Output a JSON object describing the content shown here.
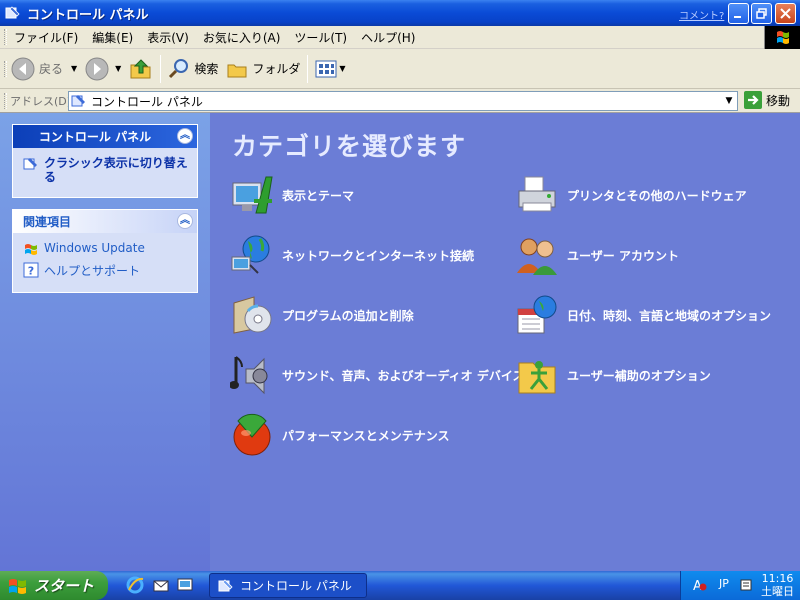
{
  "window": {
    "title": "コントロール パネル",
    "comment_link": "コメント?"
  },
  "menu": [
    "ファイル(F)",
    "編集(E)",
    "表示(V)",
    "お気に入り(A)",
    "ツール(T)",
    "ヘルプ(H)"
  ],
  "toolbar": {
    "back_label": "戻る",
    "search_label": "検索",
    "folders_label": "フォルダ"
  },
  "address": {
    "label": "アドレス(D)",
    "value": "コントロール パネル",
    "go_label": "移動"
  },
  "sidebar": {
    "panel1": {
      "title": "コントロール パネル",
      "link": "クラシック表示に切り替える"
    },
    "panel2": {
      "title": "関連項目",
      "links": [
        "Windows Update",
        "ヘルプとサポート"
      ]
    }
  },
  "main": {
    "heading": "カテゴリを選びます",
    "categories": [
      "表示とテーマ",
      "プリンタとその他のハードウェア",
      "ネットワークとインターネット接続",
      "ユーザー アカウント",
      "プログラムの追加と削除",
      "日付、時刻、言語と地域のオプション",
      "サウンド、音声、およびオーディオ デバイス",
      "ユーザー補助のオプション",
      "パフォーマンスとメンテナンス"
    ]
  },
  "taskbar": {
    "start_label": "スタート",
    "task_label": "コントロール パネル",
    "tray_ime": "JP",
    "clock_time": "11:16",
    "clock_day": "土曜日"
  },
  "colors": {
    "main_bg": "#6b7dd6",
    "title_bar": "#0a4bd6",
    "link_blue": "#215dc6"
  }
}
